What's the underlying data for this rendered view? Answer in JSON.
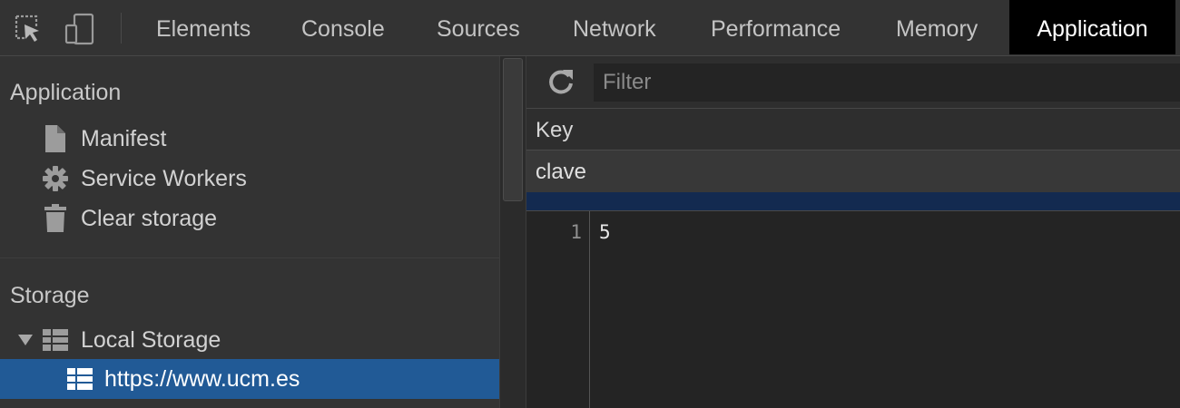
{
  "toolbar": {
    "inspect_icon": "inspect-element-icon",
    "device_icon": "device-toolbar-icon"
  },
  "tabs": [
    {
      "label": "Elements"
    },
    {
      "label": "Console"
    },
    {
      "label": "Sources"
    },
    {
      "label": "Network"
    },
    {
      "label": "Performance"
    },
    {
      "label": "Memory"
    },
    {
      "label": "Application",
      "active": true
    }
  ],
  "sidebar": {
    "application_title": "Application",
    "application_items": [
      {
        "label": "Manifest",
        "icon": "document-icon"
      },
      {
        "label": "Service Workers",
        "icon": "gear-icon"
      },
      {
        "label": "Clear storage",
        "icon": "trash-icon"
      }
    ],
    "storage_title": "Storage",
    "local_storage": {
      "label": "Local Storage",
      "icon": "table-icon",
      "expanded": true
    },
    "local_storage_origin": {
      "label": "https://www.ucm.es",
      "icon": "table-icon",
      "selected": true
    }
  },
  "panel": {
    "filter_placeholder": "Filter",
    "refresh_icon": "refresh-icon",
    "header_key": "Key",
    "row_key": "clave",
    "line_number": "1",
    "value": "5"
  },
  "colors": {
    "selected": "#215a96",
    "active_tab": "#000000",
    "strip": "#132a50"
  }
}
